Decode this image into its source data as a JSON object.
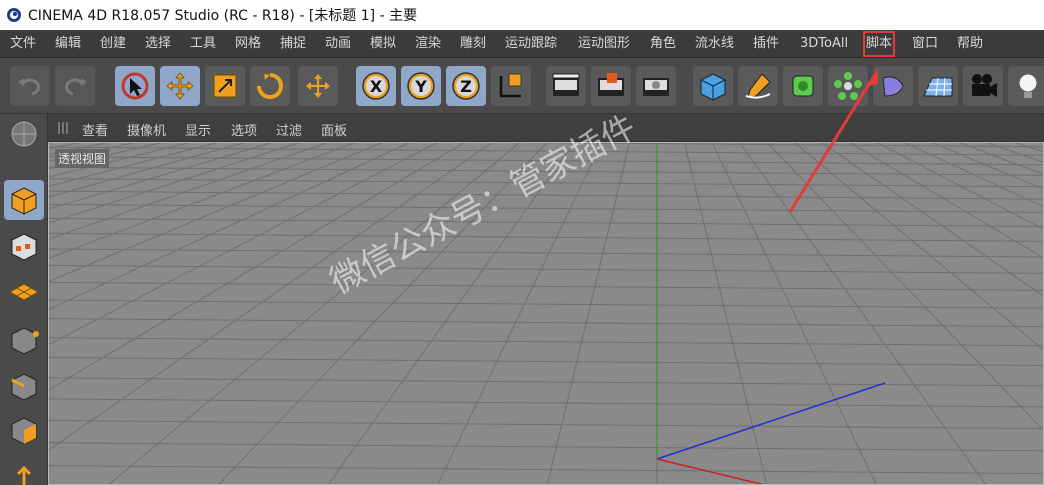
{
  "window": {
    "title": "CINEMA 4D R18.057 Studio (RC - R18) - [未标题 1] - 主要"
  },
  "menubar": {
    "items": [
      {
        "label": "文件"
      },
      {
        "label": "编辑"
      },
      {
        "label": "创建"
      },
      {
        "label": "选择"
      },
      {
        "label": "工具"
      },
      {
        "label": "网格"
      },
      {
        "label": "捕捉"
      },
      {
        "label": "动画"
      },
      {
        "label": "模拟"
      },
      {
        "label": "渲染"
      },
      {
        "label": "雕刻"
      },
      {
        "label": "运动跟踪"
      },
      {
        "label": "运动图形"
      },
      {
        "label": "角色"
      },
      {
        "label": "流水线"
      },
      {
        "label": "插件"
      },
      {
        "label": "3DToAll"
      },
      {
        "label": "脚本",
        "highlighted": true
      },
      {
        "label": "窗口"
      },
      {
        "label": "帮助"
      }
    ]
  },
  "toolbar": {
    "icons": [
      "undo-icon",
      "redo-icon",
      "select-cursor-icon",
      "move-icon",
      "scale-icon",
      "rotate-icon",
      "last-tool-icon",
      "x-axis-icon",
      "y-axis-icon",
      "z-axis-icon",
      "coordinate-system-icon",
      "render-view-icon",
      "render-to-picture-viewer-icon",
      "render-settings-icon",
      "cube-icon",
      "pen-spline-icon",
      "subdivision-icon",
      "array-icon",
      "deformer-icon",
      "floor-icon",
      "camera-icon",
      "light-icon"
    ],
    "axis_labels": {
      "x": "X",
      "y": "Y",
      "z": "Z"
    }
  },
  "view_menu": {
    "items": [
      {
        "label": "查看"
      },
      {
        "label": "摄像机"
      },
      {
        "label": "显示"
      },
      {
        "label": "选项"
      },
      {
        "label": "过滤"
      },
      {
        "label": "面板"
      }
    ]
  },
  "viewport": {
    "label": "透视视图"
  },
  "left_toolbar": {
    "icons": [
      "viewport-solo-icon",
      "model-mode-icon",
      "texture-mode-icon",
      "workplane-icon",
      "points-mode-icon",
      "edges-mode-icon",
      "polygons-mode-icon",
      "enable-axis-icon"
    ]
  },
  "overlay": {
    "watermark": "微信公众号：管家插件"
  },
  "colors": {
    "highlight_box": "#e23b3b",
    "annotation_arrow": "#e23b3b",
    "active_button": "#8fa7c9",
    "viewport_bg": "#8a8a8a",
    "axis_x": "#cc2222",
    "axis_y": "#22aa22",
    "axis_z": "#2233cc"
  }
}
